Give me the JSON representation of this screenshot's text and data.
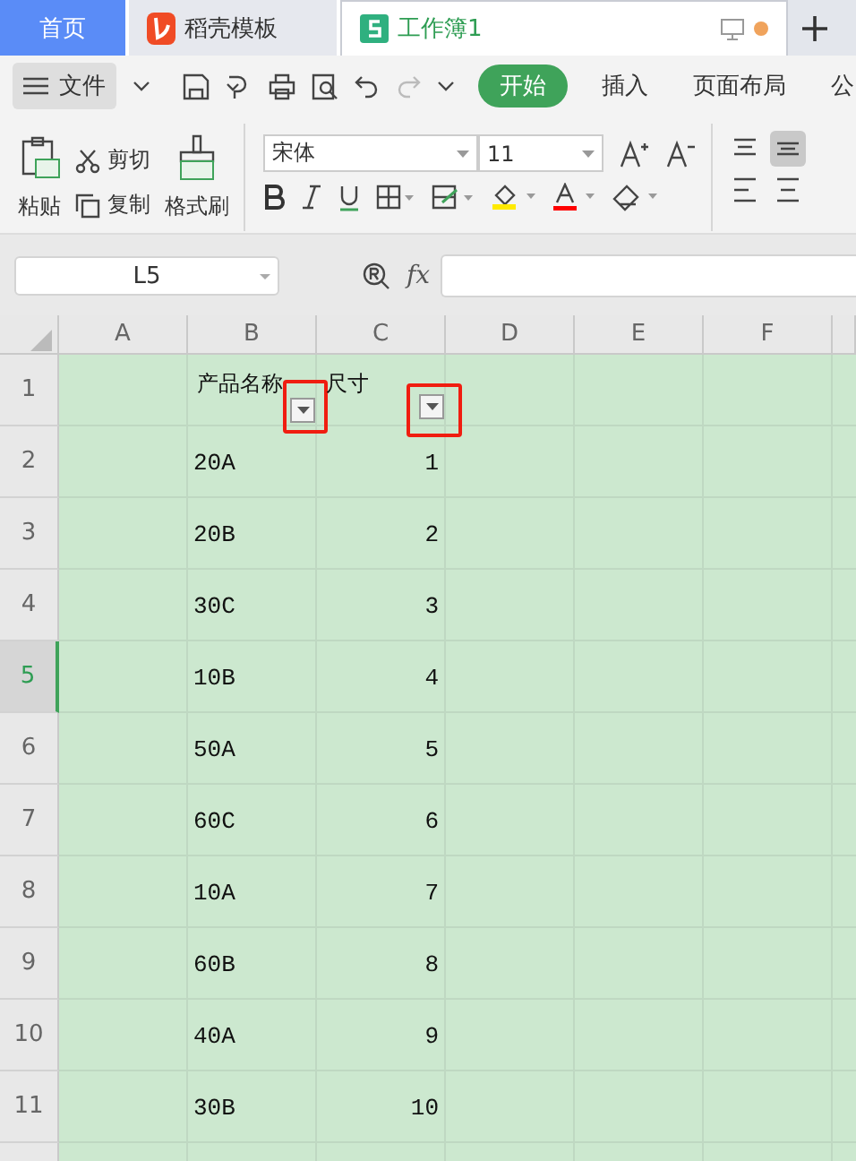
{
  "tabs": [
    {
      "label": "首页",
      "kind": "home",
      "selected": false
    },
    {
      "label": "稻壳模板",
      "kind": "docer",
      "selected": false
    },
    {
      "label": "工作簿1",
      "kind": "sheet",
      "selected": true,
      "unsaved": true
    }
  ],
  "menu": {
    "file": "文件",
    "redo_disabled": true,
    "tabs": [
      {
        "label": "开始",
        "selected": true
      },
      {
        "label": "插入",
        "selected": false
      },
      {
        "label": "页面布局",
        "selected": false
      },
      {
        "label": "公",
        "selected": false
      }
    ]
  },
  "ribbon": {
    "paste": "粘贴",
    "cut": "剪切",
    "copy": "复制",
    "format_painter": "格式刷",
    "font": "宋体",
    "font_size": "11",
    "align_center_selected": true
  },
  "formula_bar": {
    "name_box": "L5",
    "fx": "fx"
  },
  "sheet": {
    "header_filter": true,
    "columns": [
      "A",
      "B",
      "C",
      "D",
      "E",
      "F"
    ],
    "rows": [
      {
        "number": "1",
        "selected": false,
        "column_b": "产品名称",
        "column_c": "尺寸"
      },
      {
        "number": "2",
        "selected": false,
        "column_b": "20A",
        "column_c": "1"
      },
      {
        "number": "3",
        "selected": false,
        "column_b": "20B",
        "column_c": "2"
      },
      {
        "number": "4",
        "selected": false,
        "column_b": "30C",
        "column_c": "3"
      },
      {
        "number": "5",
        "selected": true,
        "column_b": "10B",
        "column_c": "4"
      },
      {
        "number": "6",
        "selected": false,
        "column_b": "50A",
        "column_c": "5"
      },
      {
        "number": "7",
        "selected": false,
        "column_b": "60C",
        "column_c": "6"
      },
      {
        "number": "8",
        "selected": false,
        "column_b": "10A",
        "column_c": "7"
      },
      {
        "number": "9",
        "selected": false,
        "column_b": "60B",
        "column_c": "8"
      },
      {
        "number": "10",
        "selected": false,
        "column_b": "40A",
        "column_c": "9"
      },
      {
        "number": "11",
        "selected": false,
        "column_b": "30B",
        "column_c": "10"
      }
    ]
  }
}
